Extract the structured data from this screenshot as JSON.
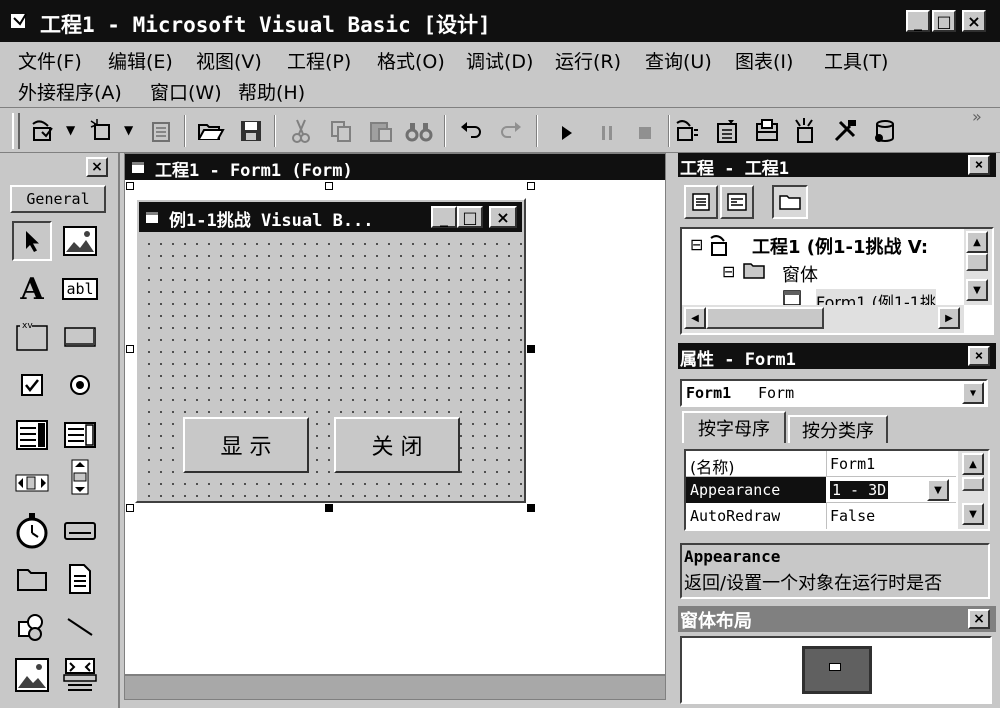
{
  "window": {
    "title": "工程1 - Microsoft Visual Basic [设计]"
  },
  "menu": {
    "row1": [
      "文件(F)",
      "编辑(E)",
      "视图(V)",
      "工程(P)",
      "格式(O)",
      "调试(D)",
      "运行(R)",
      "查询(U)",
      "图表(I)",
      "工具(T)"
    ],
    "row2": [
      "外接程序(A)",
      "窗口(W)",
      "帮助(H)"
    ]
  },
  "toolbar": {
    "overflow": "»",
    "icons": [
      "add-project-icon",
      "add-form-icon",
      "menu-editor-icon",
      "open-icon",
      "save-icon",
      "cut-icon",
      "copy-icon",
      "paste-icon",
      "find-icon",
      "undo-icon",
      "redo-icon",
      "start-icon",
      "break-icon",
      "end-icon",
      "project-explorer-icon",
      "properties-icon",
      "form-layout-icon",
      "object-browser-icon",
      "toolbox-icon",
      "data-view-icon"
    ]
  },
  "toolbox": {
    "tab_label": "General",
    "close": "×",
    "tools": [
      "pointer-icon",
      "picturebox-icon",
      "label-icon",
      "textbox-icon",
      "frame-icon",
      "commandbutton-icon",
      "checkbox-icon",
      "optionbutton-icon",
      "combobox-icon",
      "listbox-icon",
      "hscrollbar-icon",
      "vscrollbar-icon",
      "timer-icon",
      "drivelistbox-icon",
      "dirlistbox-icon",
      "filelistbox-icon",
      "shape-icon",
      "line-icon",
      "image-icon",
      "data-icon"
    ],
    "label_glyph": "A",
    "textbox_glyph": "abl",
    "frame_glyph": "xv"
  },
  "designer": {
    "title": "工程1 - Form1 (Form)",
    "form": {
      "caption": "例1-1挑战 Visual B...",
      "button1": "显 示",
      "button2": "关 闭"
    }
  },
  "project": {
    "title": "工程 - 工程1",
    "close": "×",
    "tree": [
      {
        "toggle": "⊟",
        "text": "工程1 (例1-1挑战 V:"
      },
      {
        "toggle": "⊟",
        "text": "窗体"
      },
      {
        "toggle": "",
        "text": "Form1 (例1-1挑"
      }
    ]
  },
  "properties": {
    "title": "属性 - Form1",
    "close": "×",
    "object_bold": "Form1",
    "object_type": "Form",
    "tabs": [
      "按字母序",
      "按分类序"
    ],
    "rows": [
      {
        "name": "(名称)",
        "value": "Form1"
      },
      {
        "name": "Appearance",
        "value": "1 - 3D"
      },
      {
        "name": "AutoRedraw",
        "value": "False"
      }
    ],
    "desc_title": "Appearance",
    "desc_text": "返回/设置一个对象在运行时是否"
  },
  "layout_panel": {
    "title": "窗体布局",
    "close": "×"
  },
  "caption_buttons": {
    "min": "_",
    "max": "□",
    "close": "×"
  }
}
